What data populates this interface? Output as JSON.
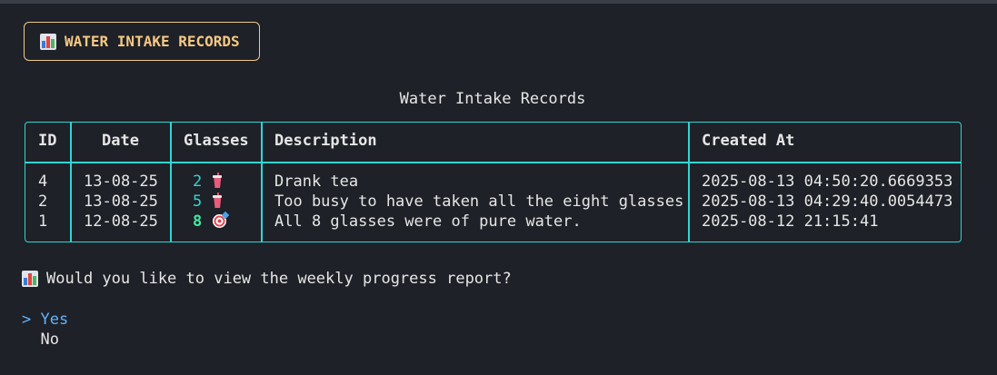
{
  "banner": {
    "icon": "bar-chart-icon",
    "title": "WATER INTAKE RECORDS"
  },
  "table": {
    "title": "Water Intake Records",
    "headers": [
      "ID",
      "Date",
      "Glasses",
      "Description",
      "Created At"
    ],
    "rows": [
      {
        "id": "4",
        "date": "13-08-25",
        "glasses": "2",
        "glasses_icon": "cup-with-straw-icon",
        "description": "Drank tea",
        "created_at": "2025-08-13 04:50:20.6669353"
      },
      {
        "id": "2",
        "date": "13-08-25",
        "glasses": "5",
        "glasses_icon": "cup-with-straw-icon",
        "description": "Too busy to have taken all the eight glasses",
        "created_at": "2025-08-13 04:29:40.0054473"
      },
      {
        "id": "1",
        "date": "12-08-25",
        "glasses": "8",
        "glasses_icon": "target-icon",
        "description": "All 8 glasses were of pure water.",
        "created_at": "2025-08-12 21:15:41"
      }
    ]
  },
  "prompt": {
    "icon": "bar-chart-icon",
    "question": "Would you like to view the weekly progress report?",
    "cursor": ">",
    "options": [
      "Yes",
      "No"
    ],
    "selected": "Yes"
  },
  "colors": {
    "background": "#1e2127",
    "table_border": "#2fd6d4",
    "banner_accent": "#f7c883",
    "selected_option": "#5fb4ff",
    "glasses_goal_met": "#43e6a0"
  }
}
